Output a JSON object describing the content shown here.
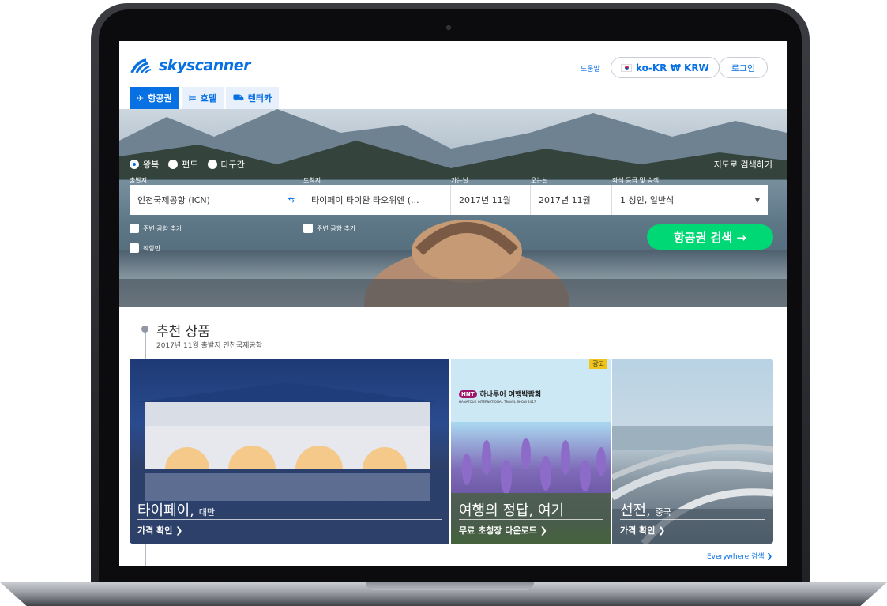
{
  "header": {
    "logo_text": "skyscanner",
    "help_label": "도움말",
    "locale_label": "ko-KR ₩ KRW",
    "login_label": "로그인"
  },
  "tabs": [
    {
      "label": "항공권",
      "icon": "plane-icon",
      "active": true
    },
    {
      "label": "호텔",
      "icon": "bed-icon",
      "active": false
    },
    {
      "label": "렌터카",
      "icon": "car-icon",
      "active": false
    }
  ],
  "search": {
    "trip_types": [
      "왕복",
      "편도",
      "다구간"
    ],
    "selected_trip_type": "왕복",
    "map_search_label": "지도로 검색하기",
    "labels": {
      "origin": "출발지",
      "destination": "도착지",
      "depart": "가는날",
      "return": "오는날",
      "cabin": "좌석 등급 및 승객"
    },
    "values": {
      "origin": "인천국제공항 (ICN)",
      "destination": "타이페이 타이완 타오위엔 (...",
      "depart": "2017년 11월",
      "return": "2017년 11월",
      "cabin": "1 성인, 일반석"
    },
    "nearby_origin": "주변 공항 추가",
    "nearby_destination": "주변 공항 추가",
    "direct_only": "직항만",
    "search_button": "항공권 검색 →"
  },
  "recommended": {
    "title": "추천 상품",
    "subtitle": "2017년 11월   출발지 인천국제공항",
    "cards": [
      {
        "title": "타이페이,",
        "subtitle": "대만",
        "link": "가격 확인 ❯"
      },
      {
        "title": "여행의 정답, 여기",
        "subtitle": "",
        "link": "무료 초청장 다운로드 ❯",
        "badge": "광고",
        "brand_text": "하나투어 여행박람회",
        "brand_small": "HANATOUR INTERNATIONAL TRAVEL SHOW 2017",
        "brand_mark": "HNT"
      },
      {
        "title": "선전,",
        "subtitle": "중국",
        "link": "가격 확인 ❯"
      }
    ],
    "everywhere_link": "Everywhere 검색 ❯"
  },
  "colors": {
    "brand_blue": "#0770e3",
    "search_green": "#00d775"
  }
}
